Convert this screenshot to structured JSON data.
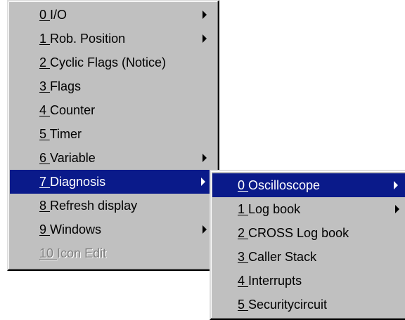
{
  "main_menu": {
    "items": [
      {
        "num": "0",
        "label": "I/O",
        "submenu": true
      },
      {
        "num": "1",
        "label": "Rob. Position",
        "submenu": true
      },
      {
        "num": "2",
        "label": "Cyclic Flags (Notice)",
        "submenu": false
      },
      {
        "num": "3",
        "label": "Flags",
        "submenu": false
      },
      {
        "num": "4",
        "label": "Counter",
        "submenu": false
      },
      {
        "num": "5",
        "label": "Timer",
        "submenu": false
      },
      {
        "num": "6",
        "label": "Variable",
        "submenu": true
      },
      {
        "num": "7",
        "label": "Diagnosis",
        "submenu": true,
        "highlighted": true
      },
      {
        "num": "8",
        "label": "Refresh display",
        "submenu": false
      },
      {
        "num": "9",
        "label": "Windows",
        "submenu": true
      },
      {
        "num": "10",
        "label": "Icon Edit",
        "submenu": false,
        "disabled": true
      }
    ]
  },
  "diagnosis_submenu": {
    "items": [
      {
        "num": "0",
        "label": "Oscilloscope",
        "submenu": true,
        "highlighted": true
      },
      {
        "num": "1",
        "label": "Log book",
        "submenu": true
      },
      {
        "num": "2",
        "label": "CROSS Log book",
        "submenu": false
      },
      {
        "num": "3",
        "label": "Caller Stack",
        "submenu": false
      },
      {
        "num": "4",
        "label": "Interrupts",
        "submenu": false
      },
      {
        "num": "5",
        "label": "Securitycircuit",
        "submenu": false
      }
    ]
  },
  "colors": {
    "menu_background": "#c0c0c0",
    "highlight": "#0a1a8a",
    "highlight_text": "#ffffff",
    "disabled_text": "#808080"
  }
}
